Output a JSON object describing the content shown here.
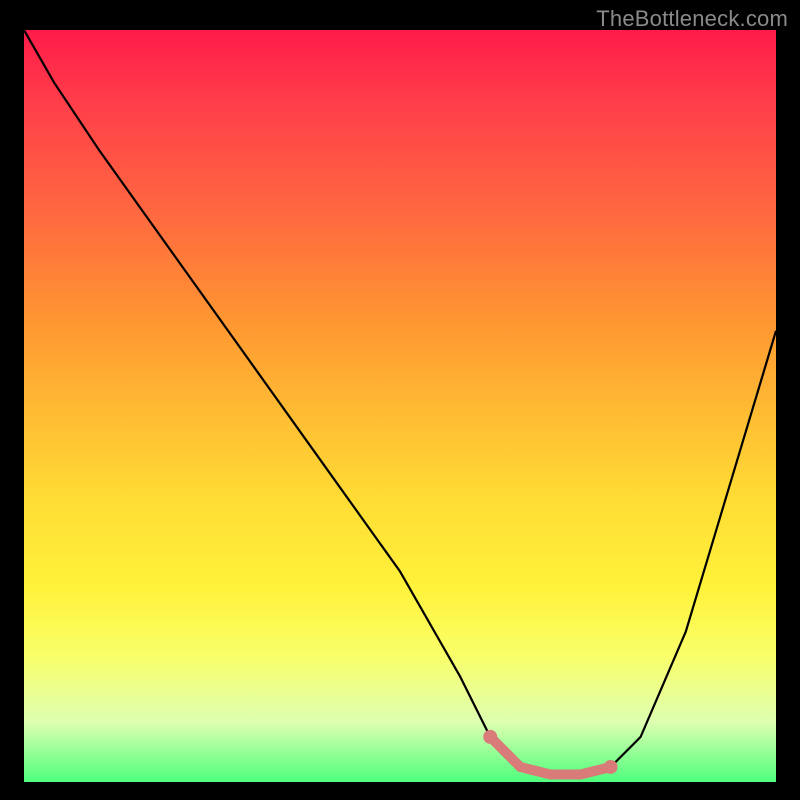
{
  "attribution": "TheBottleneck.com",
  "colors": {
    "curve": "#000000",
    "highlight": "#d97b78",
    "gradient_stops": [
      "#ff1b4a",
      "#ff3f4a",
      "#ff6a3f",
      "#ff9432",
      "#ffb933",
      "#ffdb34",
      "#fff23a",
      "#faff68",
      "#deffb1",
      "#4eff7d"
    ]
  },
  "chart_data": {
    "type": "line",
    "title": "",
    "xlabel": "",
    "ylabel": "",
    "xlim": [
      0,
      100
    ],
    "ylim": [
      0,
      100
    ],
    "grid": false,
    "series": [
      {
        "name": "bottleneck-curve",
        "x": [
          0,
          4,
          10,
          20,
          30,
          40,
          50,
          58,
          62,
          66,
          70,
          74,
          78,
          82,
          88,
          94,
          100
        ],
        "y": [
          100,
          93,
          84,
          70,
          56,
          42,
          28,
          14,
          6,
          2,
          1,
          1,
          2,
          6,
          20,
          40,
          60
        ]
      }
    ],
    "highlight": {
      "name": "optimal-range",
      "x_start": 60,
      "x_end": 80,
      "note": "trough region shown in salmon"
    }
  }
}
